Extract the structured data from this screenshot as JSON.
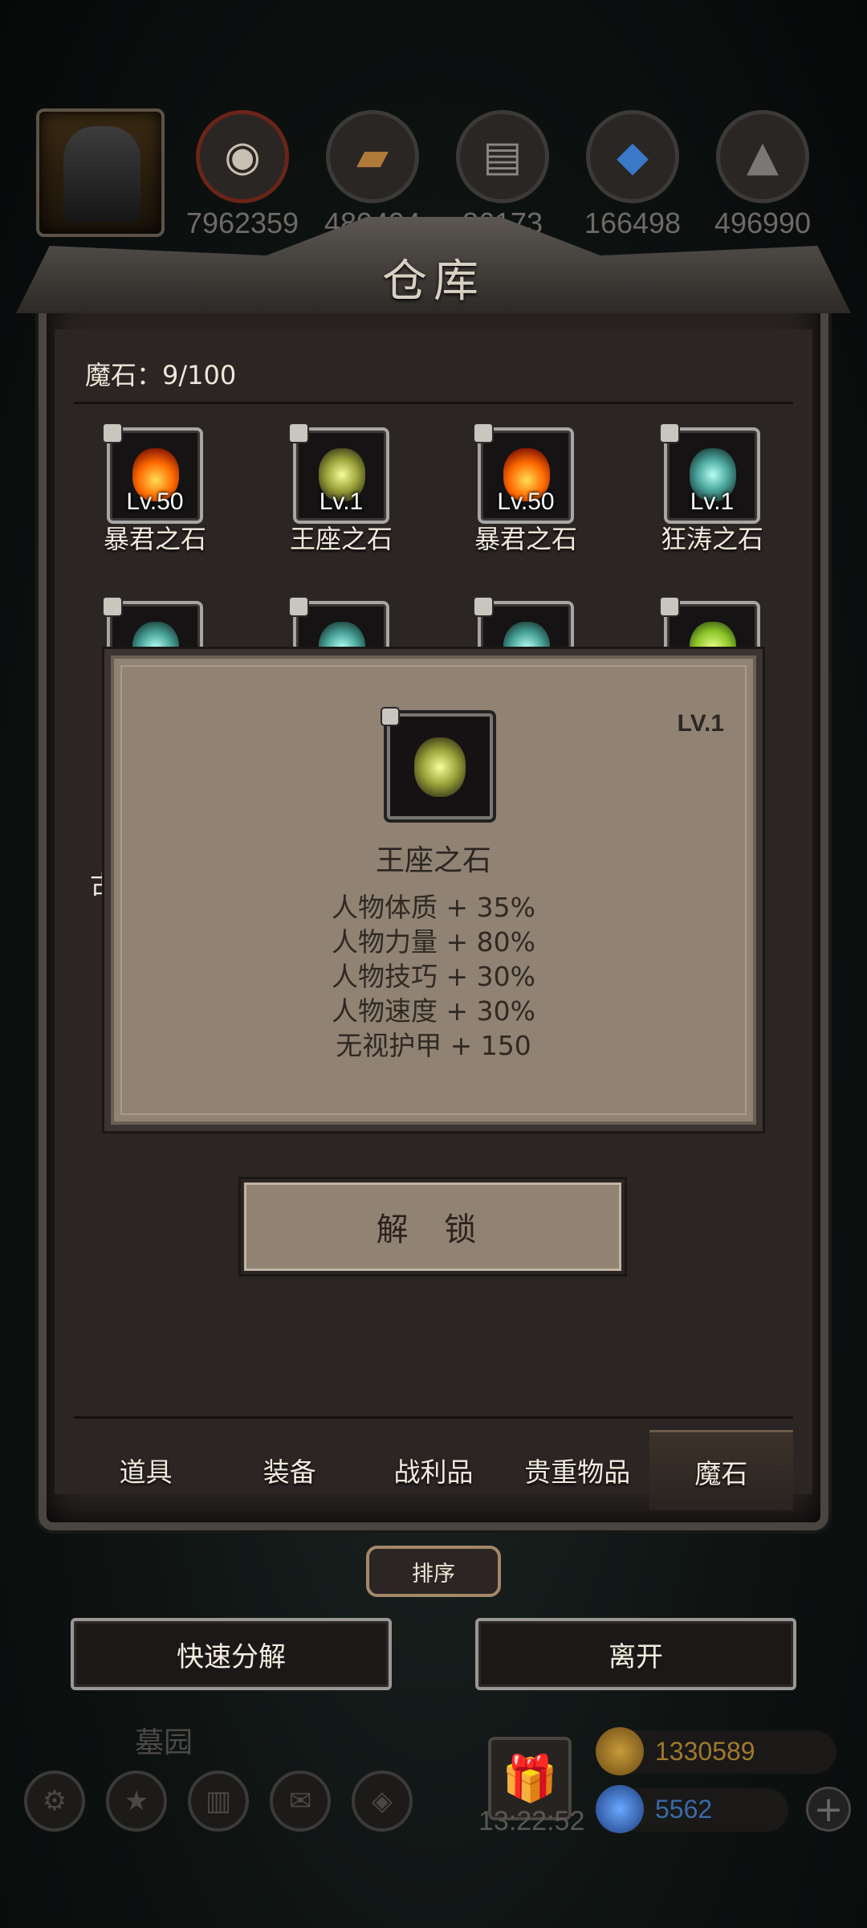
{
  "resources": {
    "values": [
      "7962359",
      "480494",
      "86173",
      "166498",
      "496990"
    ],
    "icons": [
      "meat-icon",
      "wood-icon",
      "iron-icon",
      "crystal-icon",
      "ore-icon"
    ]
  },
  "warehouse": {
    "title": "仓库",
    "count_label": "魔石：9/100"
  },
  "items_row1": [
    {
      "level": "Lv.50",
      "name": "暴君之石",
      "gem": "fire"
    },
    {
      "level": "Lv.1",
      "name": "王座之石",
      "gem": "yellow"
    },
    {
      "level": "Lv.50",
      "name": "暴君之石",
      "gem": "fire"
    },
    {
      "level": "Lv.1",
      "name": "狂涛之石",
      "gem": "cyan"
    }
  ],
  "popup": {
    "level": "LV.1",
    "name": "王座之石",
    "stats": [
      "人物体质 + 35%",
      "人物力量 + 80%",
      "人物技巧 + 30%",
      "人物速度 + 30%",
      "无视护甲 + 150"
    ],
    "partial_left_char": "古"
  },
  "unlock_button": "解 锁",
  "tabs": [
    "道具",
    "装备",
    "战利品",
    "贵重物品",
    "魔石"
  ],
  "active_tab": "魔石",
  "sort_button": "排序",
  "actions": {
    "quick_decompose": "快速分解",
    "leave": "离开"
  },
  "hud": {
    "location": "墓园",
    "timer": "13:22:52",
    "gold": "1330589",
    "gems": "5562"
  },
  "colors": {
    "popup_bg": "#908373",
    "panel_bg": "#2b2524",
    "gold_text": "#a07a2c",
    "gem_text": "#3a6aa8"
  }
}
